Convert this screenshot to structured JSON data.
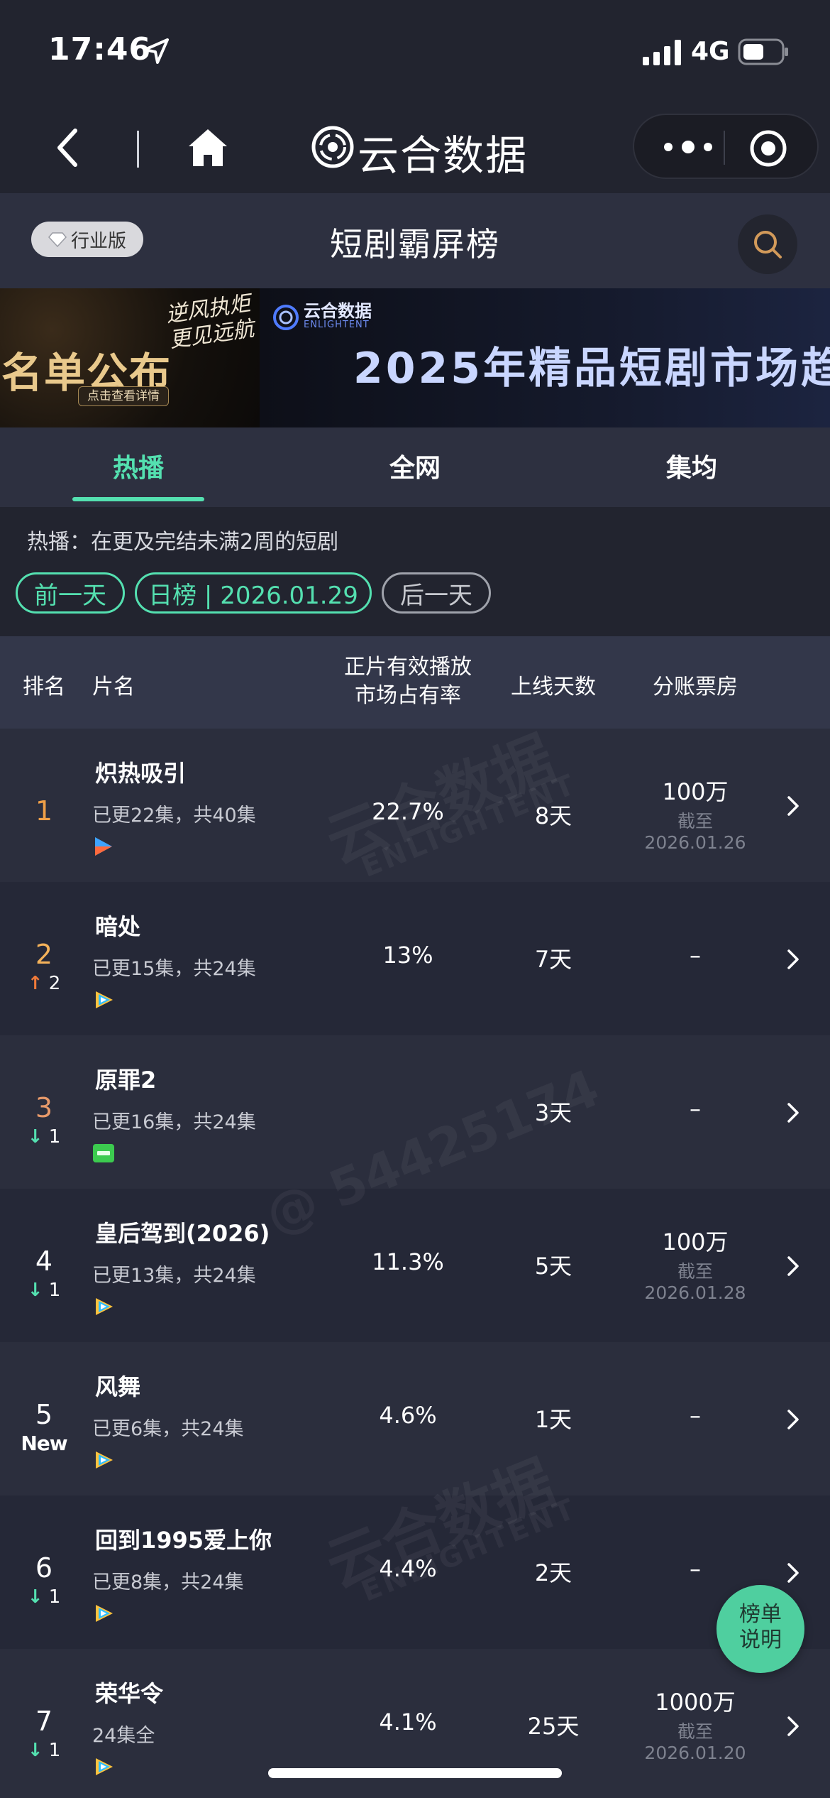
{
  "status_bar": {
    "time": "17:46",
    "network": "4G"
  },
  "nav": {
    "app_title": "云合数据"
  },
  "header": {
    "badge": "行业版",
    "title": "短剧霸屏榜"
  },
  "banner": {
    "slogan_line1": "逆风执炬",
    "slogan_line2": "更见远航",
    "left_text": "名单公布",
    "cta": "点击查看详情",
    "brand": "云合数据",
    "brand_sub": "ENLIGHTENT",
    "headline": "2025年精品短剧市场趋"
  },
  "tabs": [
    {
      "label": "热播",
      "active": true
    },
    {
      "label": "全网",
      "active": false
    },
    {
      "label": "集均",
      "active": false
    }
  ],
  "description": "热播：在更及完结未满2周的短剧",
  "date_filters": {
    "prev": "前一天",
    "current": "日榜 | 2026.01.29",
    "next": "后一天"
  },
  "table_headers": {
    "rank": "排名",
    "title": "片名",
    "share_line1": "正片有效播放",
    "share_line2": "市场占有率",
    "days": "上线天数",
    "box_office": "分账票房"
  },
  "rows": [
    {
      "rank": "1",
      "change": "",
      "title": "炽热吸引",
      "episodes": "已更22集，共40集",
      "platform": "youku-icon",
      "share": "22.7%",
      "days": "8天",
      "box": "100万",
      "as_of_label": "截至",
      "as_of_date": "2026.01.26"
    },
    {
      "rank": "2",
      "change_dir": "up",
      "change": "2",
      "title": "暗处",
      "episodes": "已更15集，共24集",
      "platform": "tencent-video-icon",
      "share": "13%",
      "days": "7天",
      "box": "–"
    },
    {
      "rank": "3",
      "change_dir": "down",
      "change": "1",
      "title": "原罪2",
      "episodes": "已更16集，共24集",
      "platform": "iqiyi-icon",
      "share": "",
      "days": "3天",
      "box": "–"
    },
    {
      "rank": "4",
      "change_dir": "down",
      "change": "1",
      "title": "皇后驾到(2026)",
      "episodes": "已更13集，共24集",
      "platform": "tencent-video-icon",
      "share": "11.3%",
      "days": "5天",
      "box": "100万",
      "as_of_label": "截至",
      "as_of_date": "2026.01.28"
    },
    {
      "rank": "5",
      "change": "New",
      "title": "风舞",
      "episodes": "已更6集，共24集",
      "platform": "tencent-video-icon",
      "share": "4.6%",
      "days": "1天",
      "box": "–"
    },
    {
      "rank": "6",
      "change_dir": "down",
      "change": "1",
      "title": "回到1995爱上你",
      "episodes": "已更8集，共24集",
      "platform": "tencent-video-icon",
      "share": "4.4%",
      "days": "2天",
      "box": "–"
    },
    {
      "rank": "7",
      "change_dir": "down",
      "change": "1",
      "title": "荣华令",
      "episodes": "24集全",
      "platform": "tencent-video-icon",
      "share": "4.1%",
      "days": "25天",
      "box": "1000万",
      "as_of_label": "截至",
      "as_of_date": "2026.01.20"
    }
  ],
  "arrows": {
    "up": "↑",
    "down": "↓"
  },
  "fab": {
    "line1": "榜单",
    "line2": "说明"
  },
  "watermark": {
    "brand_cn": "云合数据",
    "brand_en": "ENLIGHTENT",
    "user_id": "@ 54425174"
  },
  "colors": {
    "accent": "#54e0b0",
    "background": "#22242f",
    "rank1": "#f0a048",
    "up": "#f07a3a",
    "down": "#54e0b0"
  }
}
